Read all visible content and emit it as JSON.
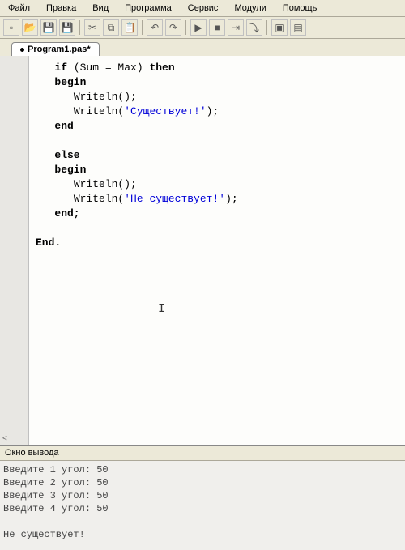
{
  "menu": {
    "items": [
      "Файл",
      "Правка",
      "Вид",
      "Программа",
      "Сервис",
      "Модули",
      "Помощь"
    ]
  },
  "tab": {
    "label": "Program1.pas*"
  },
  "code": {
    "indent1": "   ",
    "indent2": "      ",
    "if_": "if",
    "cond_open": " (Sum = Max) ",
    "then_": "then",
    "begin_": "begin",
    "writeln_empty": "Writeln();",
    "writeln_open": "Writeln(",
    "str_exists": "'Существует!'",
    "close_paren": ");",
    "end_": "end",
    "else_": "else",
    "str_notexists": "'Не существует!'",
    "end_semi": "end;",
    "final_end": "End."
  },
  "output": {
    "title": "Окно вывода",
    "lines": [
      "Введите 1 угол: 50",
      "Введите 2 угол: 50",
      "Введите 3 угол: 50",
      "Введите 4 угол: 50",
      "",
      "Не существует!"
    ]
  }
}
